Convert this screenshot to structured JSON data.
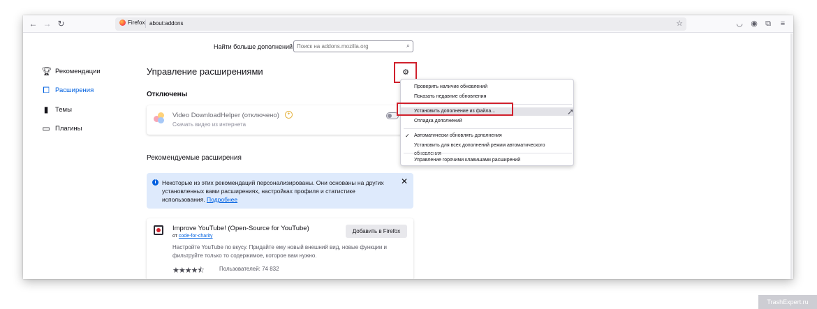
{
  "browser": {
    "identity_label": "Firefox",
    "url": "about:addons",
    "icons": [
      "back-icon",
      "forward-icon",
      "reload-icon",
      "star-icon",
      "pocket-icon",
      "account-icon",
      "extensions-icon",
      "menu-icon"
    ]
  },
  "search": {
    "label": "Найти больше дополнений",
    "placeholder": "Поиск на addons.mozilla.org"
  },
  "sidebar": {
    "items": [
      {
        "label": "Рекомендации",
        "icon": "trophy-icon"
      },
      {
        "label": "Расширения",
        "icon": "puzzle-icon",
        "active": true
      },
      {
        "label": "Темы",
        "icon": "brush-icon"
      },
      {
        "label": "Плагины",
        "icon": "folder-icon"
      }
    ]
  },
  "main": {
    "title": "Управление расширениями",
    "disabled_header": "Отключены",
    "disabled_ext": {
      "name": "Video DownloadHelper (отключено)",
      "description": "Скачать видео из интернета"
    },
    "recommended_header": "Рекомендуемые расширения",
    "notice": {
      "text": "Некоторые из этих рекомендаций персонализированы. Они основаны на других установленных вами расширениях, настройках профиля и статистике использования.",
      "link": "Подробнее"
    },
    "rec_ext": {
      "name": "Improve YouTube! (Open-Source for YouTube)",
      "by_prefix": "от",
      "author": "code-for-charity",
      "description": "Настройте YouTube по вкусу. Придайте ему новый внешний вид, новые функции и фильтруйте только то содержимое, которое вам нужно.",
      "rating": 4.5,
      "users": "Пользователей: 74 832",
      "add_button": "Добавить в Firefox"
    }
  },
  "menu": {
    "check_updates": "Проверить наличие обновлений",
    "recent_updates": "Показать недавние обновления",
    "install_from_file": "Установить дополнение из файла...",
    "debug_addons": "Отладка дополнений",
    "auto_update": "Автоматически обновлять дополнения",
    "reset_auto_update": "Установить для всех дополнений режим автоматического обновления",
    "manage_shortcuts": "Управление горячими клавишами расширений"
  },
  "watermark": "TrashExpert.ru",
  "colors": {
    "accent": "#0061e0",
    "highlight_frame": "#d0202c",
    "notice_bg": "#deeafc"
  }
}
